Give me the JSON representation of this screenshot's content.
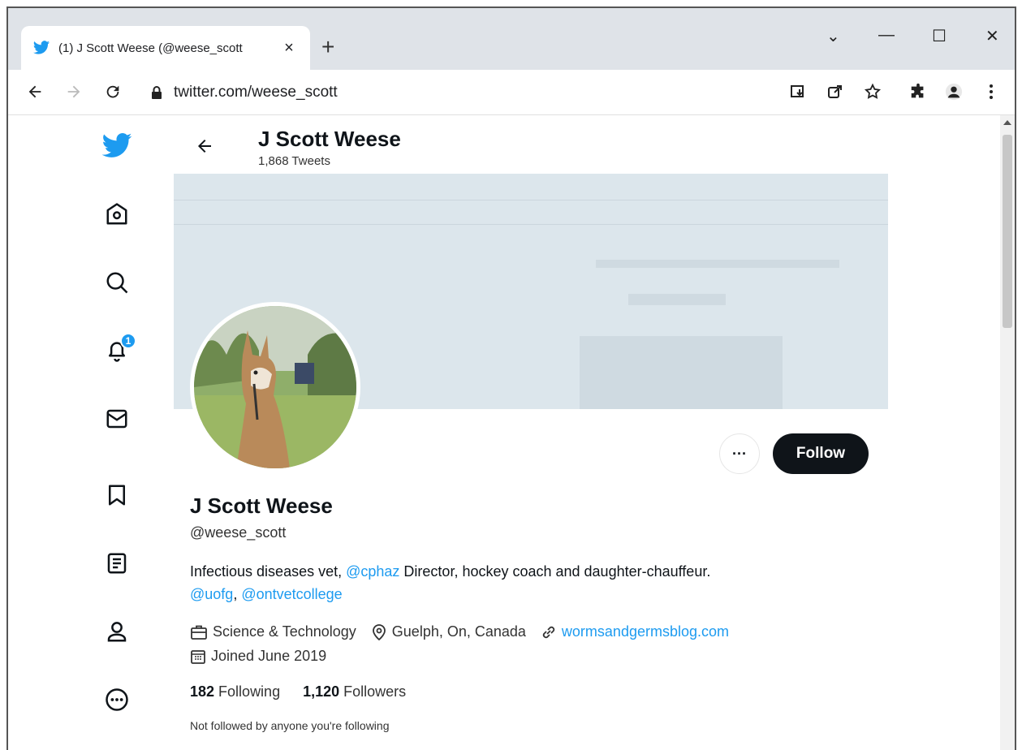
{
  "browser": {
    "tab_title": "(1) J Scott Weese (@weese_scott",
    "tab_close": "×",
    "new_tab": "+",
    "url": "twitter.com/weese_scott",
    "window_controls": [
      "⌄",
      "—",
      "☐",
      "✕"
    ]
  },
  "header": {
    "name": "J Scott Weese",
    "tweet_count": "1,868 Tweets"
  },
  "nav": {
    "notification_count": "1",
    "items": [
      "home",
      "explore",
      "notifications",
      "messages",
      "bookmarks",
      "lists",
      "profile",
      "more"
    ]
  },
  "profile": {
    "name": "J Scott Weese",
    "handle": "@weese_scott",
    "more_label": "···",
    "follow_label": "Follow",
    "bio": {
      "part1": "Infectious diseases vet, ",
      "mention1": "@cphaz",
      "part2": " Director, hockey coach and daughter-chauffeur.",
      "mention2": "@uofg",
      "sep": ", ",
      "mention3": "@ontvetcollege"
    },
    "category": "Science & Technology",
    "location": "Guelph, On, Canada",
    "website": "wormsandgermsblog.com",
    "joined": "Joined June 2019",
    "following_count": "182",
    "following_label": " Following",
    "followers_count": "1,120",
    "followers_label": " Followers",
    "not_followed": "Not followed by anyone you're following"
  },
  "colors": {
    "brand": "#1d9bf0",
    "follow_bg": "#0f1419"
  }
}
